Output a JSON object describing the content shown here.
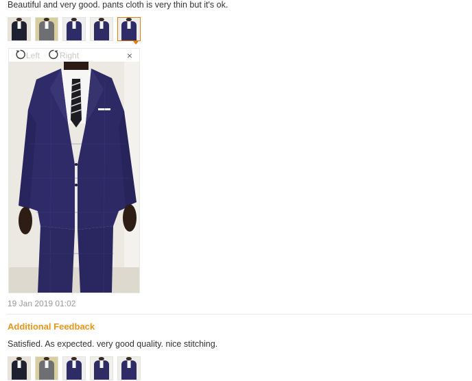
{
  "review": {
    "text": "Beautiful and very good. pants cloth is very thin but it's ok.",
    "thumbnails": [
      {
        "suit_color": "#1e2230",
        "bg": "#e9e2d7"
      },
      {
        "suit_color": "#6d6f72",
        "bg": "#d8cf9e"
      },
      {
        "suit_color": "#2d2c66",
        "bg": "#eeeeee"
      },
      {
        "suit_color": "#2f2b63",
        "bg": "#f0efea"
      },
      {
        "suit_color": "#2f2b66",
        "bg": "#efede7"
      }
    ],
    "active_thumbnail_index": 4
  },
  "viewer": {
    "rotate_left_label": "Left",
    "rotate_right_label": "Right",
    "close_label": "×",
    "rotate_left_icon": "rotate-left-icon",
    "rotate_right_icon": "rotate-right-icon"
  },
  "date": "19 Jan 2019 01:02",
  "additional_feedback": {
    "title": "Additional Feedback",
    "text": "Satisfied. As expected. very good quality. nice stitching.",
    "thumbnails": [
      {
        "suit_color": "#1e2230",
        "bg": "#e9e2d7"
      },
      {
        "suit_color": "#6d6f72",
        "bg": "#d8cf9e"
      },
      {
        "suit_color": "#2d2c66",
        "bg": "#eeeeee"
      },
      {
        "suit_color": "#2f2b63",
        "bg": "#f0efea"
      },
      {
        "suit_color": "#2f2b66",
        "bg": "#efede7"
      }
    ]
  },
  "colors": {
    "accent": "#e8790c",
    "feedback_title": "#e8961c",
    "suit_navy": "#2f2b68"
  }
}
